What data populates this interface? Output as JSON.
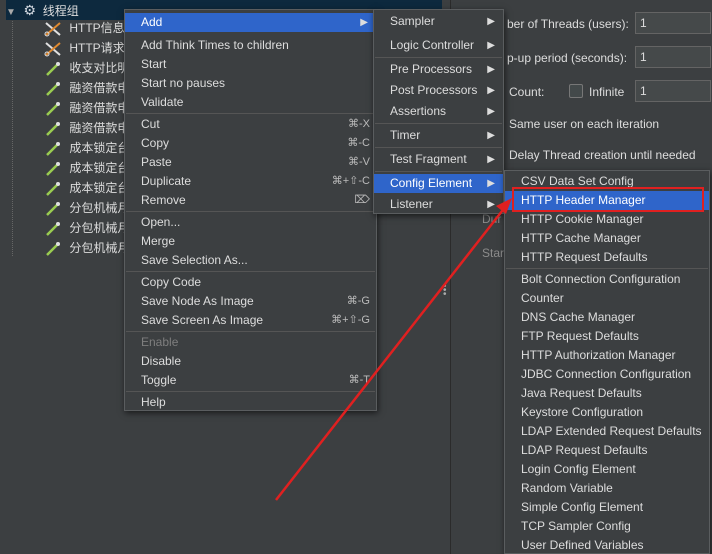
{
  "tree": {
    "root_label": "线程组",
    "items": [
      {
        "label": "HTTP信息",
        "icon": "scissors-icon"
      },
      {
        "label": "HTTP请求",
        "icon": "scissors-icon"
      },
      {
        "label": "收支对比明",
        "icon": "pipette-icon"
      },
      {
        "label": "融资借款申",
        "icon": "pipette-icon"
      },
      {
        "label": "融资借款申",
        "icon": "pipette-icon"
      },
      {
        "label": "融资借款申",
        "icon": "pipette-icon"
      },
      {
        "label": "成本锁定台",
        "icon": "pipette-icon"
      },
      {
        "label": "成本锁定台",
        "icon": "pipette-icon"
      },
      {
        "label": "成本锁定台",
        "icon": "pipette-icon"
      },
      {
        "label": "分包机械月",
        "icon": "pipette-icon"
      },
      {
        "label": "分包机械月",
        "icon": "pipette-icon"
      },
      {
        "label": "分包机械月",
        "icon": "pipette-icon"
      }
    ]
  },
  "right_panel": {
    "threads_label": "ber of Threads (users):",
    "threads_value": "1",
    "rampup_label": "p-up period (seconds):",
    "rampup_value": "1",
    "loop_label": "Count:",
    "infinite_label": "Infinite",
    "loop_value": "1",
    "same_user_label": "Same user on each iteration",
    "delay_label": "Delay Thread creation until needed",
    "dur_label": "Dur",
    "start_label": "Star"
  },
  "context_menu": {
    "items": [
      {
        "label": "Add",
        "shortcut": "",
        "submenu": true,
        "active": true
      },
      {
        "label": "Add Think Times to children"
      },
      {
        "label": "Start"
      },
      {
        "label": "Start no pauses"
      },
      {
        "label": "Validate"
      },
      {
        "label": "Cut",
        "shortcut": "⌘-X"
      },
      {
        "label": "Copy",
        "shortcut": "⌘-C"
      },
      {
        "label": "Paste",
        "shortcut": "⌘-V"
      },
      {
        "label": "Duplicate",
        "shortcut": "⌘+⇧-C"
      },
      {
        "label": "Remove",
        "shortcut": "⌦"
      },
      {
        "label": "Open..."
      },
      {
        "label": "Merge"
      },
      {
        "label": "Save Selection As..."
      },
      {
        "label": "Copy Code"
      },
      {
        "label": "Save Node As Image",
        "shortcut": "⌘-G"
      },
      {
        "label": "Save Screen As Image",
        "shortcut": "⌘+⇧-G"
      },
      {
        "label": "Enable",
        "disabled": true
      },
      {
        "label": "Disable"
      },
      {
        "label": "Toggle",
        "shortcut": "⌘-T"
      },
      {
        "label": "Help"
      }
    ]
  },
  "add_submenu": {
    "items": [
      {
        "label": "Sampler"
      },
      {
        "label": "Logic Controller"
      },
      {
        "label": "Pre Processors"
      },
      {
        "label": "Post Processors"
      },
      {
        "label": "Assertions"
      },
      {
        "label": "Timer"
      },
      {
        "label": "Test Fragment"
      },
      {
        "label": "Config Element"
      },
      {
        "label": "Listener"
      }
    ]
  },
  "config_submenu": {
    "items": [
      "CSV Data Set Config",
      "HTTP Header Manager",
      "HTTP Cookie Manager",
      "HTTP Cache Manager",
      "HTTP Request Defaults",
      "Bolt Connection Configuration",
      "Counter",
      "DNS Cache Manager",
      "FTP Request Defaults",
      "HTTP Authorization Manager",
      "JDBC Connection Configuration",
      "Java Request Defaults",
      "Keystore Configuration",
      "LDAP Extended Request Defaults",
      "LDAP Request Defaults",
      "Login Config Element",
      "Random Variable",
      "Simple Config Element",
      "TCP Sampler Config",
      "User Defined Variables"
    ]
  },
  "colors": {
    "highlight": "#2f65ca",
    "annotation": "#e02020"
  }
}
